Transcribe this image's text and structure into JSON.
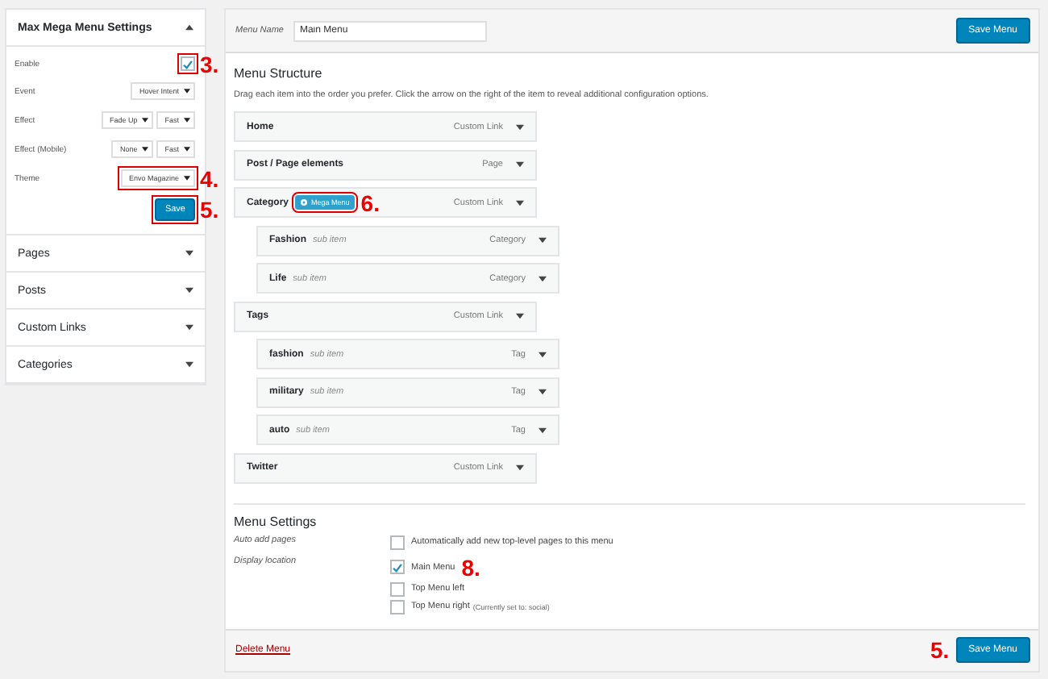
{
  "sidebar": {
    "settings_panel": {
      "title": "Max Mega Menu Settings",
      "expanded": true,
      "fields": [
        {
          "kind": "checkbox",
          "label": "Enable",
          "checked": true,
          "annotation": "3."
        },
        {
          "kind": "select",
          "label": "Event",
          "selects": [
            "Hover Intent"
          ]
        },
        {
          "kind": "select",
          "label": "Effect",
          "selects": [
            "Fade Up",
            "Fast"
          ]
        },
        {
          "kind": "select",
          "label": "Effect (Mobile)",
          "selects": [
            "None",
            "Fast"
          ]
        },
        {
          "kind": "select",
          "label": "Theme",
          "selects": [
            "Envo Magazine"
          ],
          "annotation": "4."
        }
      ],
      "save_button": {
        "label": "Save",
        "annotation": "5."
      }
    },
    "accordions": [
      {
        "title": "Pages",
        "expanded": false
      },
      {
        "title": "Posts",
        "expanded": false
      },
      {
        "title": "Custom Links",
        "expanded": false
      },
      {
        "title": "Categories",
        "expanded": false
      }
    ]
  },
  "header": {
    "menu_name_label": "Menu Name",
    "menu_name_value": "Main Menu",
    "save_button": "Save Menu"
  },
  "menu_structure": {
    "title": "Menu Structure",
    "description": "Drag each item into the order you prefer. Click the arrow on the right of the item to reveal additional configuration options.",
    "items": [
      {
        "title": "Home",
        "type": "Custom Link"
      },
      {
        "title": "Post / Page elements",
        "type": "Page"
      },
      {
        "title": "Category",
        "type": "Custom Link",
        "badge": "Mega Menu",
        "annotation": "6.",
        "children": [
          {
            "title": "Fashion",
            "sub_label": "sub item",
            "type": "Category"
          },
          {
            "title": "Life",
            "sub_label": "sub item",
            "type": "Category"
          }
        ]
      },
      {
        "title": "Tags",
        "type": "Custom Link",
        "children": [
          {
            "title": "fashion",
            "sub_label": "sub item",
            "type": "Tag"
          },
          {
            "title": "military",
            "sub_label": "sub item",
            "type": "Tag"
          },
          {
            "title": "auto",
            "sub_label": "sub item",
            "type": "Tag"
          }
        ]
      },
      {
        "title": "Twitter",
        "type": "Custom Link"
      }
    ]
  },
  "menu_settings": {
    "title": "Menu Settings",
    "auto_add": {
      "label": "Auto add pages",
      "options": [
        {
          "label": "Automatically add new top-level pages to this menu",
          "checked": false
        }
      ]
    },
    "display_location": {
      "label": "Display location",
      "options": [
        {
          "label": "Main Menu",
          "checked": true,
          "annotation": "8."
        },
        {
          "label": "Top Menu left",
          "checked": false
        },
        {
          "label": "Top Menu right",
          "note": "(Currently set to: social)",
          "checked": false
        }
      ]
    }
  },
  "footer": {
    "delete_link": "Delete Menu",
    "save_button": "Save Menu",
    "annotation": "5."
  }
}
